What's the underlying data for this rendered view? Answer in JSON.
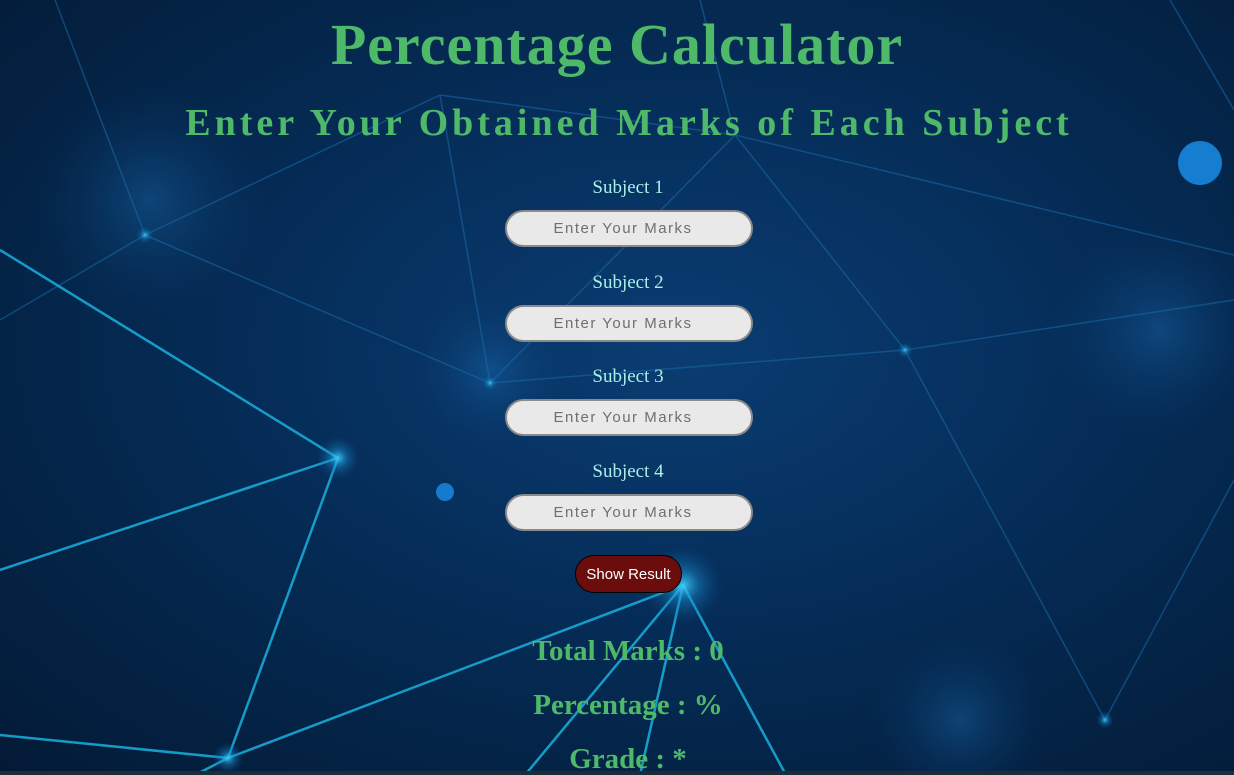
{
  "page": {
    "title": "Percentage Calculator",
    "subtitle": "Enter Your Obtained Marks of Each Subject"
  },
  "subjects": [
    {
      "label": "Subject 1",
      "placeholder": "Enter Your Marks",
      "value": ""
    },
    {
      "label": "Subject 2",
      "placeholder": "Enter Your Marks",
      "value": ""
    },
    {
      "label": "Subject 3",
      "placeholder": "Enter Your Marks",
      "value": ""
    },
    {
      "label": "Subject 4",
      "placeholder": "Enter Your Marks",
      "value": ""
    }
  ],
  "actions": {
    "show_result_label": "Show Result"
  },
  "results": {
    "total": "Total Marks : 0",
    "percentage": "Percentage : %",
    "grade": "Grade : *"
  },
  "colors": {
    "heading": "#4fb96a",
    "label": "#a9f0e8",
    "button": "#6b0d0d",
    "background": "#06305e",
    "network_lines": "#18a9d6"
  }
}
